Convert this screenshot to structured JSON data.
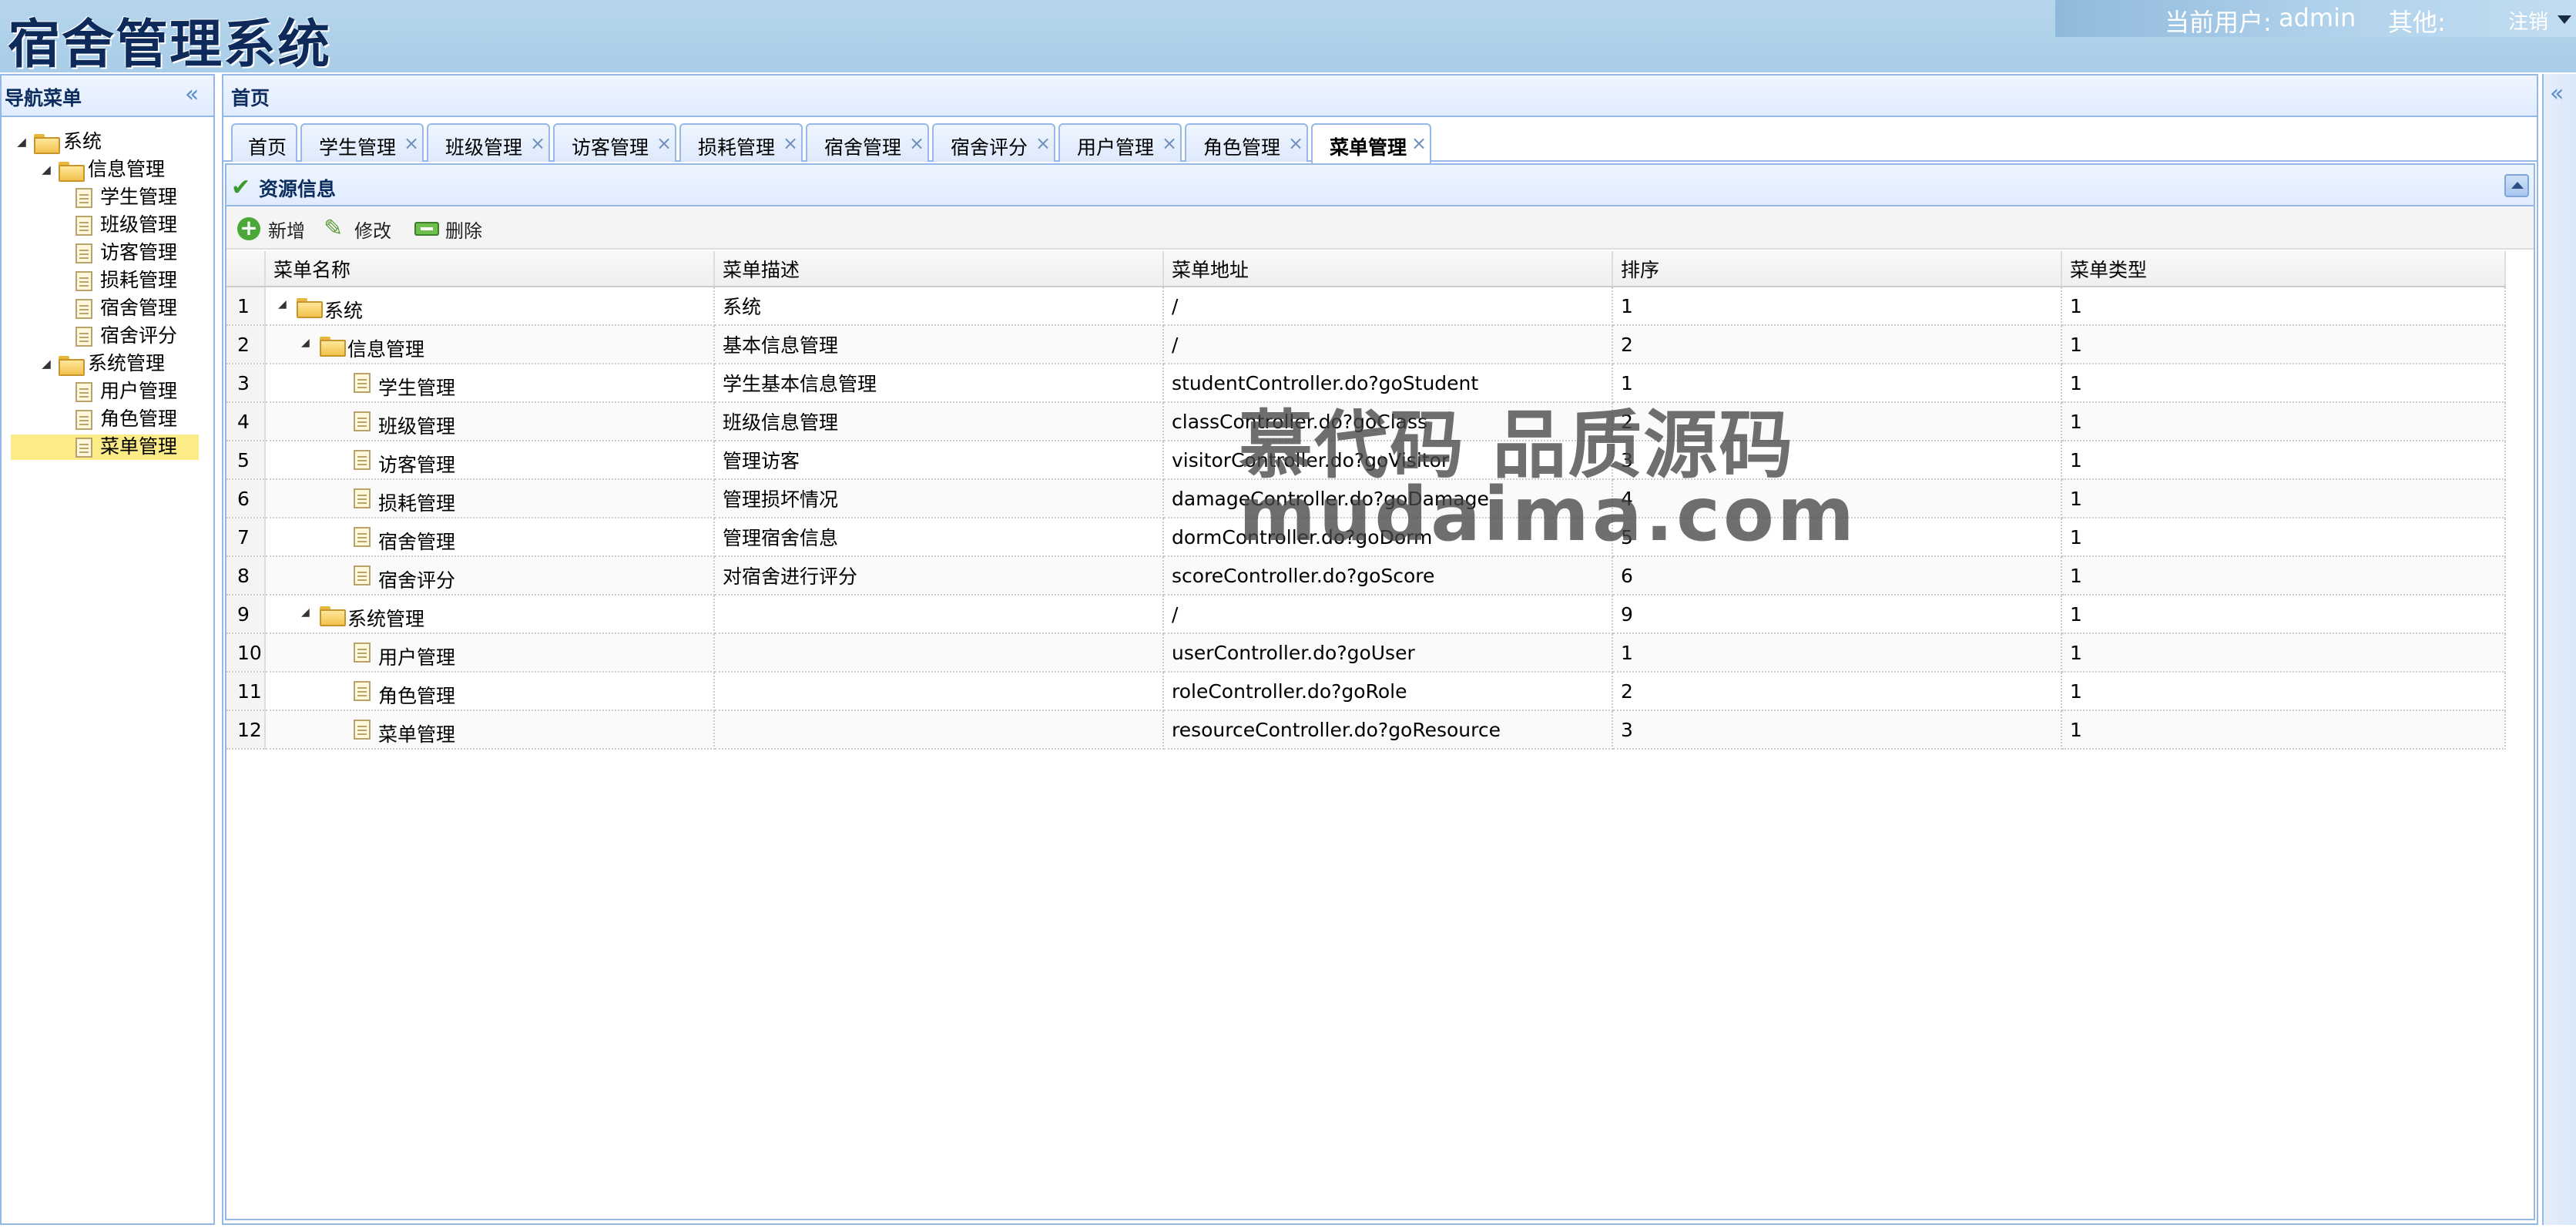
{
  "header": {
    "app_title": "宿舍管理系统",
    "user_label": "当前用户:",
    "user_name": "admin",
    "other_label": "其他:",
    "logout": "注销"
  },
  "nav": {
    "title": "导航菜单",
    "collapse_icon": "«",
    "tree": [
      {
        "label": "系统",
        "level": 0,
        "type": "folder"
      },
      {
        "label": "信息管理",
        "level": 1,
        "type": "folder"
      },
      {
        "label": "学生管理",
        "level": 2,
        "type": "file"
      },
      {
        "label": "班级管理",
        "level": 2,
        "type": "file"
      },
      {
        "label": "访客管理",
        "level": 2,
        "type": "file"
      },
      {
        "label": "损耗管理",
        "level": 2,
        "type": "file"
      },
      {
        "label": "宿舍管理",
        "level": 2,
        "type": "file"
      },
      {
        "label": "宿舍评分",
        "level": 2,
        "type": "file"
      },
      {
        "label": "系统管理",
        "level": 1,
        "type": "folder"
      },
      {
        "label": "用户管理",
        "level": 2,
        "type": "file"
      },
      {
        "label": "角色管理",
        "level": 2,
        "type": "file"
      },
      {
        "label": "菜单管理",
        "level": 2,
        "type": "file",
        "selected": true
      }
    ]
  },
  "center": {
    "title": "首页",
    "tabs": [
      {
        "label": "首页",
        "closable": false
      },
      {
        "label": "学生管理",
        "closable": true
      },
      {
        "label": "班级管理",
        "closable": true
      },
      {
        "label": "访客管理",
        "closable": true
      },
      {
        "label": "损耗管理",
        "closable": true
      },
      {
        "label": "宿舍管理",
        "closable": true
      },
      {
        "label": "宿舍评分",
        "closable": true
      },
      {
        "label": "用户管理",
        "closable": true
      },
      {
        "label": "角色管理",
        "closable": true
      },
      {
        "label": "菜单管理",
        "closable": true,
        "active": true
      }
    ],
    "close_glyph": "×"
  },
  "panel": {
    "title": "资源信息",
    "toolbar": {
      "add": "新增",
      "edit": "修改",
      "delete": "删除"
    }
  },
  "grid": {
    "columns": [
      "菜单名称",
      "菜单描述",
      "菜单地址",
      "排序",
      "菜单类型"
    ],
    "rows": [
      {
        "no": "1",
        "name": "系统",
        "level": 0,
        "type": "folder",
        "desc": "系统",
        "url": "/",
        "order": "1",
        "menu_type": "1"
      },
      {
        "no": "2",
        "name": "信息管理",
        "level": 1,
        "type": "folder",
        "desc": "基本信息管理",
        "url": "/",
        "order": "2",
        "menu_type": "1"
      },
      {
        "no": "3",
        "name": "学生管理",
        "level": 2,
        "type": "file",
        "desc": "学生基本信息管理",
        "url": "studentController.do?goStudent",
        "order": "1",
        "menu_type": "1"
      },
      {
        "no": "4",
        "name": "班级管理",
        "level": 2,
        "type": "file",
        "desc": "班级信息管理",
        "url": "classController.do?goClass",
        "order": "2",
        "menu_type": "1"
      },
      {
        "no": "5",
        "name": "访客管理",
        "level": 2,
        "type": "file",
        "desc": "管理访客",
        "url": "visitorController.do?goVisitor",
        "order": "3",
        "menu_type": "1"
      },
      {
        "no": "6",
        "name": "损耗管理",
        "level": 2,
        "type": "file",
        "desc": "管理损坏情况",
        "url": "damageController.do?goDamage",
        "order": "4",
        "menu_type": "1"
      },
      {
        "no": "7",
        "name": "宿舍管理",
        "level": 2,
        "type": "file",
        "desc": "管理宿舍信息",
        "url": "dormController.do?goDorm",
        "order": "5",
        "menu_type": "1"
      },
      {
        "no": "8",
        "name": "宿舍评分",
        "level": 2,
        "type": "file",
        "desc": "对宿舍进行评分",
        "url": "scoreController.do?goScore",
        "order": "6",
        "menu_type": "1"
      },
      {
        "no": "9",
        "name": "系统管理",
        "level": 1,
        "type": "folder",
        "desc": "",
        "url": "/",
        "order": "9",
        "menu_type": "1"
      },
      {
        "no": "10",
        "name": "用户管理",
        "level": 2,
        "type": "file",
        "desc": "",
        "url": "userController.do?goUser",
        "order": "1",
        "menu_type": "1"
      },
      {
        "no": "11",
        "name": "角色管理",
        "level": 2,
        "type": "file",
        "desc": "",
        "url": "roleController.do?goRole",
        "order": "2",
        "menu_type": "1"
      },
      {
        "no": "12",
        "name": "菜单管理",
        "level": 2,
        "type": "file",
        "desc": "",
        "url": "resourceController.do?goResource",
        "order": "3",
        "menu_type": "1"
      }
    ]
  },
  "watermark": {
    "line1": "慕代码 品质源码",
    "line2": "mudaima.com"
  },
  "east": {
    "expand_icon": "«"
  }
}
